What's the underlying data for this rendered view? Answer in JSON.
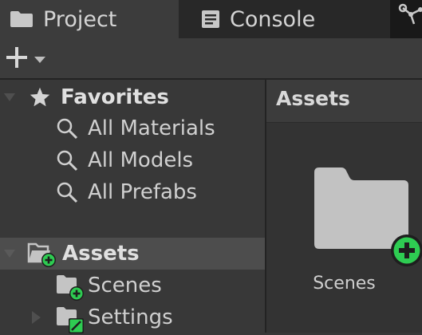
{
  "tabs": [
    {
      "label": "Project",
      "icon": "folder-icon"
    },
    {
      "label": "Console",
      "icon": "console-icon"
    },
    {
      "label": "",
      "icon": "node-graph-icon"
    }
  ],
  "toolbar": {
    "add_icon": "plus-icon",
    "dropdown_icon": "caret-down-icon"
  },
  "tree": {
    "favorites": {
      "label": "Favorites",
      "items": [
        {
          "label": "All Materials"
        },
        {
          "label": "All Models"
        },
        {
          "label": "All Prefabs"
        }
      ]
    },
    "assets": {
      "label": "Assets",
      "children": [
        {
          "label": "Scenes"
        },
        {
          "label": "Settings"
        }
      ]
    }
  },
  "browser": {
    "title": "Assets",
    "items": [
      {
        "label": "Scenes",
        "icon": "folder-add-icon"
      }
    ]
  },
  "colors": {
    "badge_green": "#2ecc52",
    "selection": "#4d4d4d",
    "folder": "#c2c2c2"
  }
}
